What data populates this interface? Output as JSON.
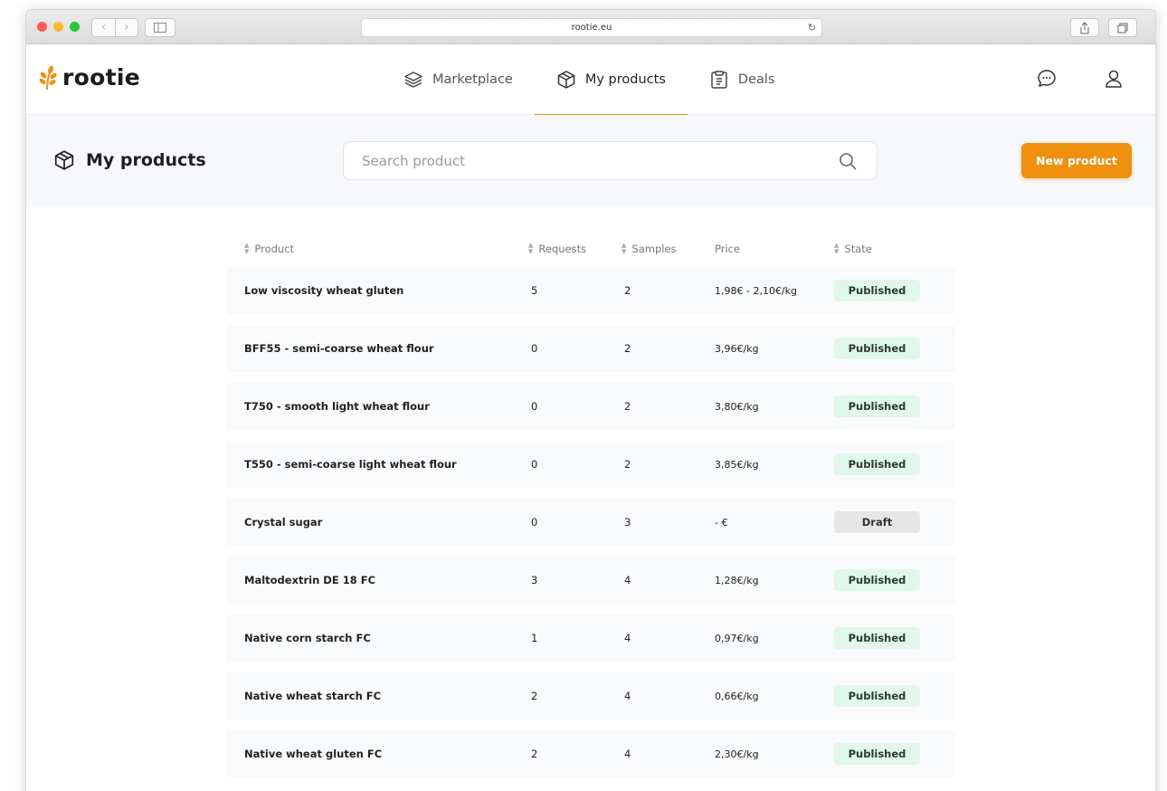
{
  "browser": {
    "url": "rootie.eu"
  },
  "app": {
    "logo_text": "rootie",
    "brand_color": "#f0900f"
  },
  "nav": {
    "items": [
      {
        "label": "Marketplace",
        "icon": "layers-icon",
        "active": false
      },
      {
        "label": "My products",
        "icon": "box-icon",
        "active": true
      },
      {
        "label": "Deals",
        "icon": "document-icon",
        "active": false
      }
    ]
  },
  "header_icons": [
    "chat-icon",
    "user-icon"
  ],
  "page": {
    "title": "My products",
    "search_placeholder": "Search product",
    "new_button": "New product"
  },
  "table": {
    "columns": [
      "Product",
      "Requests",
      "Samples",
      "Price",
      "State"
    ],
    "rows": [
      {
        "product": "Low viscosity wheat gluten",
        "requests": "5",
        "samples": "2",
        "price": "1,98€ - 2,10€/kg",
        "state": "Published"
      },
      {
        "product": "BFF55 - semi-coarse wheat flour",
        "requests": "0",
        "samples": "2",
        "price": "3,96€/kg",
        "state": "Published"
      },
      {
        "product": "T750 - smooth light wheat flour",
        "requests": "0",
        "samples": "2",
        "price": "3,80€/kg",
        "state": "Published"
      },
      {
        "product": "T550 - semi-coarse light wheat flour",
        "requests": "0",
        "samples": "2",
        "price": "3,85€/kg",
        "state": "Published"
      },
      {
        "product": "Crystal sugar",
        "requests": "0",
        "samples": "3",
        "price": "- €",
        "state": "Draft"
      },
      {
        "product": "Maltodextrin DE 18 FC",
        "requests": "3",
        "samples": "4",
        "price": "1,28€/kg",
        "state": "Published"
      },
      {
        "product": "Native corn starch FC",
        "requests": "1",
        "samples": "4",
        "price": "0,97€/kg",
        "state": "Published"
      },
      {
        "product": "Native wheat starch FC",
        "requests": "2",
        "samples": "4",
        "price": "0,66€/kg",
        "state": "Published"
      },
      {
        "product": "Native wheat gluten FC",
        "requests": "2",
        "samples": "4",
        "price": "2,30€/kg",
        "state": "Published"
      }
    ]
  }
}
